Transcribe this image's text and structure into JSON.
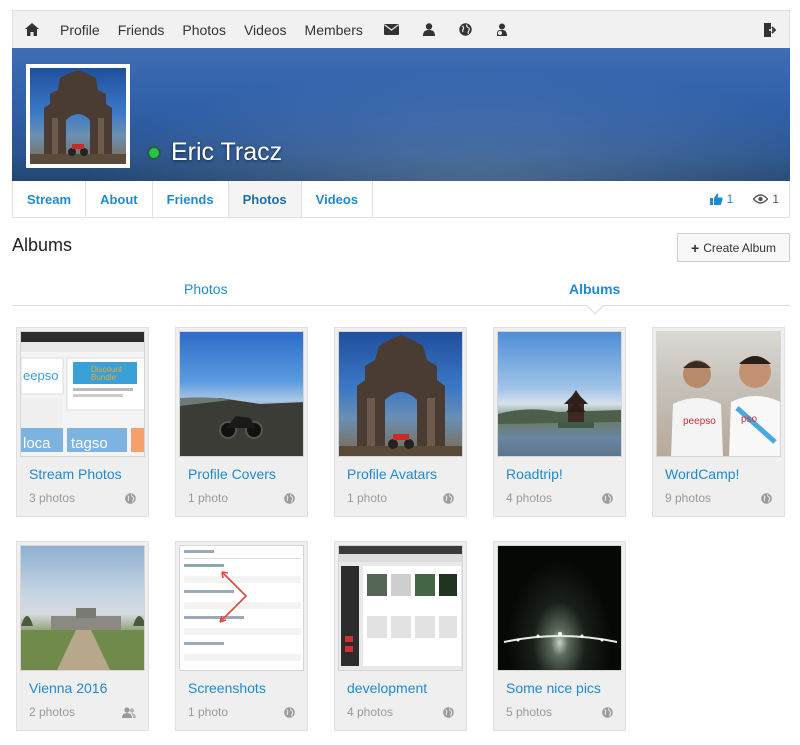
{
  "topnav": {
    "items": [
      "Profile",
      "Friends",
      "Photos",
      "Videos",
      "Members"
    ],
    "icons": [
      "home-icon",
      "envelope-icon",
      "user-icon",
      "globe-icon",
      "user-plus-icon",
      "sign-out-icon"
    ]
  },
  "profile": {
    "name": "Eric Tracz",
    "online": true
  },
  "profile_tabs": [
    "Stream",
    "About",
    "Friends",
    "Photos",
    "Videos"
  ],
  "active_profile_tab": "Photos",
  "stats": {
    "likes": "1",
    "views": "1"
  },
  "albums_section": {
    "title": "Albums",
    "create_button": "Create Album",
    "subtabs": [
      "Photos",
      "Albums"
    ],
    "active_subtab": "Albums"
  },
  "albums": [
    {
      "name": "Stream Photos",
      "count": "3 photos",
      "privacy": "globe-icon"
    },
    {
      "name": "Profile Covers",
      "count": "1 photo",
      "privacy": "globe-icon"
    },
    {
      "name": "Profile Avatars",
      "count": "1 photo",
      "privacy": "globe-icon"
    },
    {
      "name": "Roadtrip!",
      "count": "4 photos",
      "privacy": "globe-icon"
    },
    {
      "name": "WordCamp!",
      "count": "9 photos",
      "privacy": "globe-icon"
    },
    {
      "name": "Vienna 2016",
      "count": "2 photos",
      "privacy": "friends-icon"
    },
    {
      "name": "Screenshots",
      "count": "1 photo",
      "privacy": "globe-icon"
    },
    {
      "name": "development",
      "count": "4 photos",
      "privacy": "globe-icon"
    },
    {
      "name": "Some nice pics",
      "count": "5 photos",
      "privacy": "globe-icon"
    }
  ],
  "colors": {
    "link": "#1e8bd0",
    "online": "#27c24c",
    "card_bg": "#efefef"
  }
}
